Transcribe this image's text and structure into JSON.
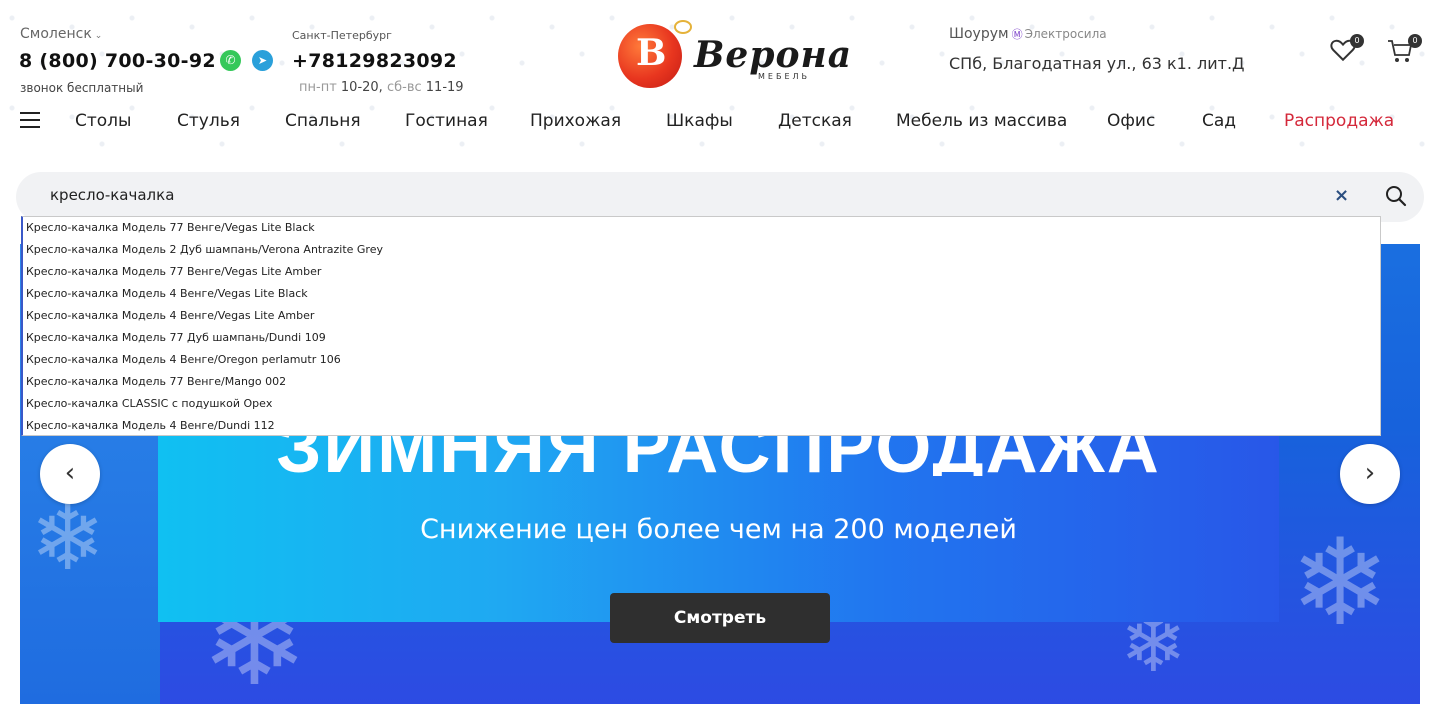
{
  "header": {
    "city": "Смоленск",
    "phone_main": "8 (800) 700-30-92",
    "phone_note": "звонок бесплатный",
    "city2": "Санкт-Петербург",
    "phone2": "+78129823092",
    "hours_weekday_label": "пн-пт",
    "hours_weekday": "10-20,",
    "hours_weekend_label": "сб-вс",
    "hours_weekend": "11-19",
    "logo_text": "Верона",
    "logo_sub": "МЕБЕЛЬ",
    "showroom_label": "Шоурум",
    "metro_symbol": "Ⓜ",
    "metro_station": "Электросила",
    "address": "СПб, Благодатная ул., 63 к1. лит.Д",
    "favorites_count": "0",
    "cart_count": "0"
  },
  "nav": {
    "items": [
      {
        "label": "Столы"
      },
      {
        "label": "Стулья"
      },
      {
        "label": "Спальня"
      },
      {
        "label": "Гостиная"
      },
      {
        "label": "Прихожая"
      },
      {
        "label": "Шкафы"
      },
      {
        "label": "Детская"
      },
      {
        "label": "Мебель из массива"
      },
      {
        "label": "Офис"
      },
      {
        "label": "Сад"
      },
      {
        "label": "Распродажа"
      }
    ]
  },
  "search": {
    "value": "кресло-качалка",
    "clear_symbol": "×"
  },
  "suggestions": [
    "Кресло-качалка Модель 77 Венге/Vegas Lite Black",
    "Кресло-качалка Модель 2 Дуб шампань/Verona Antrazite Grey",
    "Кресло-качалка Модель 77 Венге/Vegas Lite Amber",
    "Кресло-качалка Модель 4 Венге/Vegas Lite Black",
    "Кресло-качалка Модель 4 Венге/Vegas Lite Amber",
    "Кресло-качалка Модель 77 Дуб шампань/Dundi 109",
    "Кресло-качалка Модель 4 Венге/Oregon perlamutr 106",
    "Кресло-качалка Модель 77 Венге/Mango 002",
    "Кресло-качалка CLASSIC с подушкой Орех",
    "Кресло-качалка Модель 4 Венге/Dundi 112"
  ],
  "banner": {
    "title": "ЗИМНЯЯ РАСПРОДАЖА",
    "subtitle": "Снижение цен более чем на 200 моделей",
    "button_label": "Смотреть",
    "prev_symbol": "‹",
    "next_symbol": "›"
  },
  "colors": {
    "sale": "#d4283a",
    "whatsapp": "#35c85a",
    "telegram": "#2aa0da",
    "banner_dark_button": "#2f2f2f"
  }
}
